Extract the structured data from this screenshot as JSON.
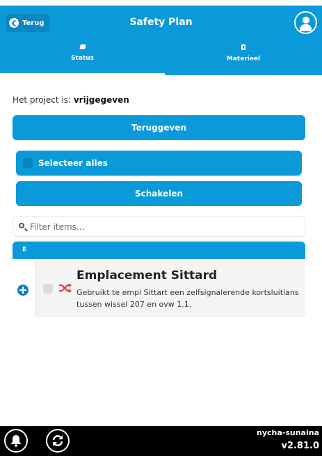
{
  "header": {
    "back_label": "Terug",
    "title": "Safety Plan",
    "user_icon": "user-icon"
  },
  "tabs": [
    {
      "label": "Status",
      "icon": "status-icon",
      "active": true
    },
    {
      "label": "Materieel",
      "icon": "mobile-icon",
      "active": false
    }
  ],
  "project": {
    "prefix": "Het project is: ",
    "state": "vrijgegeven"
  },
  "actions": {
    "teruggeven": "Teruggeven",
    "select_all": "Selecteer alles",
    "schakelen": "Schakelen"
  },
  "filter": {
    "placeholder": "Filter items...",
    "value": ""
  },
  "groups": [
    {
      "header": "E",
      "items": [
        {
          "title": "Emplacement Sittard",
          "description": "Gebruikt te empl Sittart een zelfsignalerende kortsluitlans tussen wissel 207 en ovw 1.1.",
          "icon": "shuffle-icon"
        }
      ]
    }
  ],
  "footer": {
    "user": "nycha-sunaina",
    "version": "v2.81.0"
  },
  "colors": {
    "primary": "#0a99d9",
    "primary_dark": "#0c86c0",
    "shuffle_red": "#e53935",
    "footer_bg": "#000000"
  }
}
